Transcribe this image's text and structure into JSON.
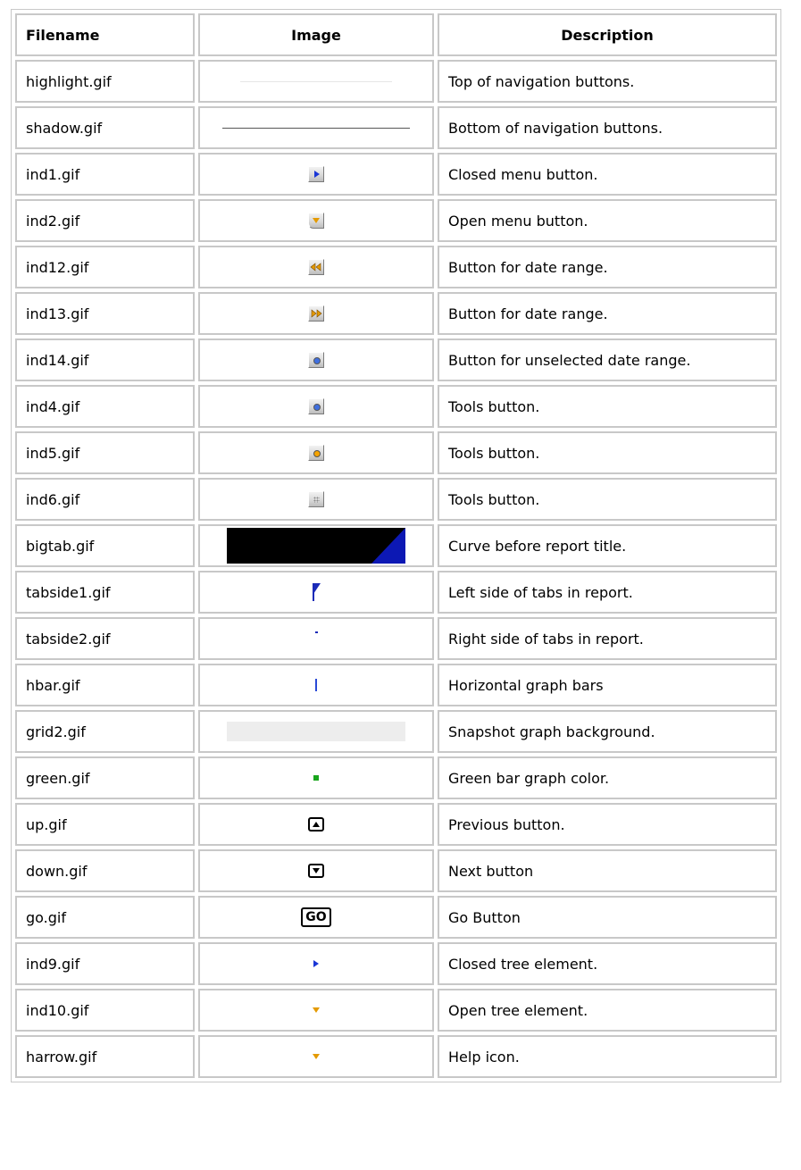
{
  "headers": {
    "filename": "Filename",
    "image": "Image",
    "description": "Description"
  },
  "rows": [
    {
      "filename": "highlight.gif",
      "description": "Top of navigation buttons.",
      "icon": "highlight-line-icon"
    },
    {
      "filename": "shadow.gif",
      "description": "Bottom of navigation buttons.",
      "icon": "shadow-line-icon"
    },
    {
      "filename": "ind1.gif",
      "description": "Closed menu button.",
      "icon": "closed-menu-button-icon"
    },
    {
      "filename": "ind2.gif",
      "description": "Open menu button.",
      "icon": "open-menu-button-icon"
    },
    {
      "filename": "ind12.gif",
      "description": "Button for date range.",
      "icon": "date-range-back-icon"
    },
    {
      "filename": "ind13.gif",
      "description": "Button for date range.",
      "icon": "date-range-forward-icon"
    },
    {
      "filename": "ind14.gif",
      "description": "Button for unselected date range.",
      "icon": "unselected-date-range-icon"
    },
    {
      "filename": "ind4.gif",
      "description": "Tools button.",
      "icon": "tools-button-blue-icon"
    },
    {
      "filename": "ind5.gif",
      "description": "Tools button.",
      "icon": "tools-button-orange-icon"
    },
    {
      "filename": "ind6.gif",
      "description": "Tools button.",
      "icon": "tools-button-grid-icon"
    },
    {
      "filename": "bigtab.gif",
      "description": "Curve before report title.",
      "icon": "bigtab-icon"
    },
    {
      "filename": "tabside1.gif",
      "description": "Left side of tabs in report.",
      "icon": "tab-left-side-icon"
    },
    {
      "filename": "tabside2.gif",
      "description": "Right side of tabs in report.",
      "icon": "tab-right-side-icon"
    },
    {
      "filename": "hbar.gif",
      "description": "Horizontal graph bars",
      "icon": "horizontal-bar-icon"
    },
    {
      "filename": "grid2.gif",
      "description": "Snapshot graph background.",
      "icon": "graph-background-icon"
    },
    {
      "filename": "green.gif",
      "description": "Green bar graph color.",
      "icon": "green-square-icon"
    },
    {
      "filename": "up.gif",
      "description": "Previous button.",
      "icon": "up-arrow-button-icon"
    },
    {
      "filename": "down.gif",
      "description": "Next button",
      "icon": "down-arrow-button-icon"
    },
    {
      "filename": "go.gif",
      "description": "Go Button",
      "icon": "go-button-icon",
      "label": "GO"
    },
    {
      "filename": "ind9.gif",
      "description": "Closed tree element.",
      "icon": "closed-tree-arrow-icon"
    },
    {
      "filename": "ind10.gif",
      "description": "Open tree element.",
      "icon": "open-tree-arrow-icon"
    },
    {
      "filename": "harrow.gif",
      "description": "Help icon.",
      "icon": "help-arrow-icon"
    }
  ],
  "colors": {
    "border": "#c8c8c8",
    "blue": "#1a36d6",
    "orange": "#e49a00",
    "green": "#18a51c",
    "navy": "#0c18b4"
  }
}
